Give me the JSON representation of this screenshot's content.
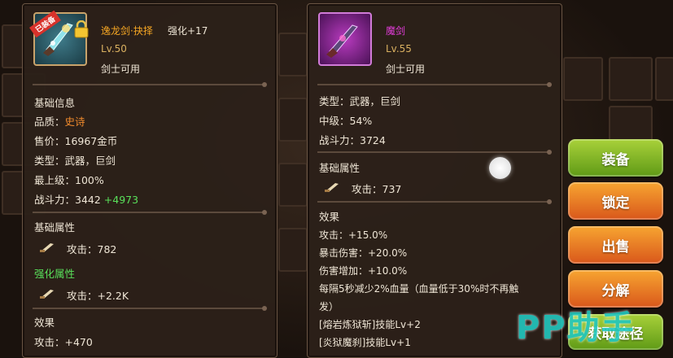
{
  "left_item": {
    "badge": "已装备",
    "name": "逸龙剑·抉择",
    "enhance": "强化+17",
    "level": "Lv.50",
    "class_req": "剑士可用",
    "basic_info_title": "基础信息",
    "quality_label": "品质：",
    "quality_value": "史诗",
    "price": "售价：16967金币",
    "type": "类型：武器，巨剑",
    "max_level": "最上级：100%",
    "power_label": "战斗力：3442",
    "power_bonus": "+4973",
    "base_attr_title": "基础属性",
    "base_attack": "攻击：782",
    "enhance_attr_title": "强化属性",
    "enhance_attack": "攻击：+2.2K",
    "effect_title": "效果",
    "effect_attack": "攻击：+470"
  },
  "right_item": {
    "name": "魔剑",
    "level": "Lv.55",
    "class_req": "剑士可用",
    "type": "类型：武器，巨剑",
    "mid_level": "中级：54%",
    "power": "战斗力：3724",
    "base_attr_title": "基础属性",
    "base_attack": "攻击：737",
    "effect_title": "效果",
    "effects": [
      "攻击：+15.0%",
      "暴击伤害：+20.0%",
      "伤害增加：+10.0%",
      "每隔5秒减少2%血量（血量低于30%时不再触",
      "发）",
      "[熔岩炼狱斩]技能Lv+2",
      "[炎狱魔刹]技能Lv+1"
    ]
  },
  "actions": {
    "equip": "装备",
    "lock": "锁定",
    "sell": "出售",
    "decompose": "分解",
    "fetch": "获取途径"
  },
  "watermark": "PP助手",
  "colors": {
    "epic_orange": "#f08a2c",
    "name_orange": "#f5a623",
    "green": "#59e05a",
    "magenta": "#e03cd7",
    "level_gold": "#d9b060"
  }
}
